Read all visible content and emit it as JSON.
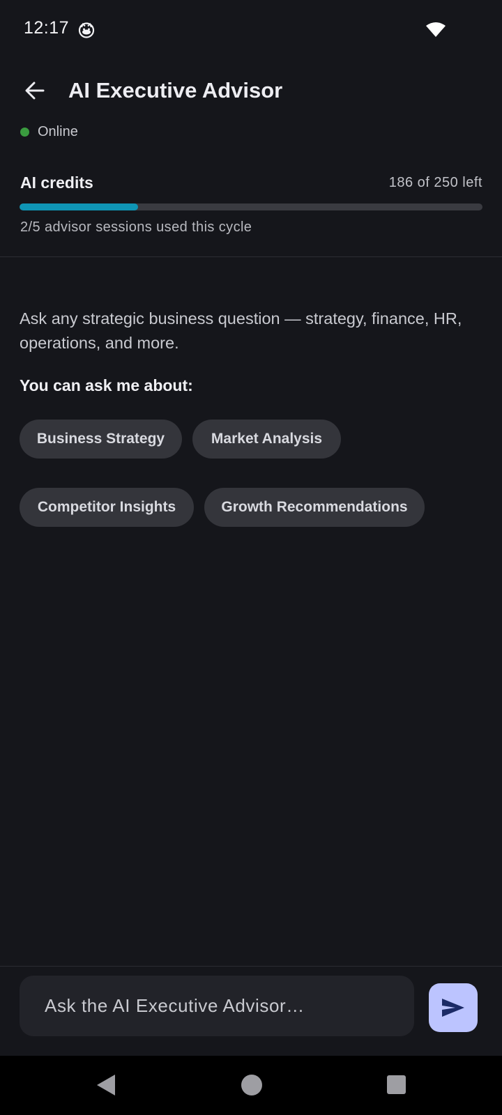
{
  "status_bar": {
    "time": "12:17",
    "notification_icon": "cat-face-icon",
    "wifi_icon": "wifi-icon"
  },
  "header": {
    "back_icon": "arrow-left-icon",
    "title": "AI Executive Advisor",
    "status_label": "Online",
    "status_color": "#3a9b3f"
  },
  "credits": {
    "label": "AI credits",
    "remaining_text": "186 of 250 left",
    "used_fraction": 0.256,
    "bar_color": "#0f95b5",
    "sessions_text": "2/5 advisor sessions used this cycle"
  },
  "intro": {
    "description": "Ask any strategic business question — strategy, finance, HR, operations, and more.",
    "topics_heading": "You can ask me about:",
    "topics": [
      "Business Strategy",
      "Market Analysis",
      "Competitor Insights",
      "Growth Recommendations"
    ]
  },
  "composer": {
    "placeholder": "Ask the AI Executive Advisor…",
    "value": "",
    "send_icon": "send-icon",
    "send_color": "#bcc4ff"
  },
  "nav_bar": {
    "back_icon": "triangle-back-icon",
    "home_icon": "circle-home-icon",
    "recents_icon": "square-recents-icon"
  }
}
